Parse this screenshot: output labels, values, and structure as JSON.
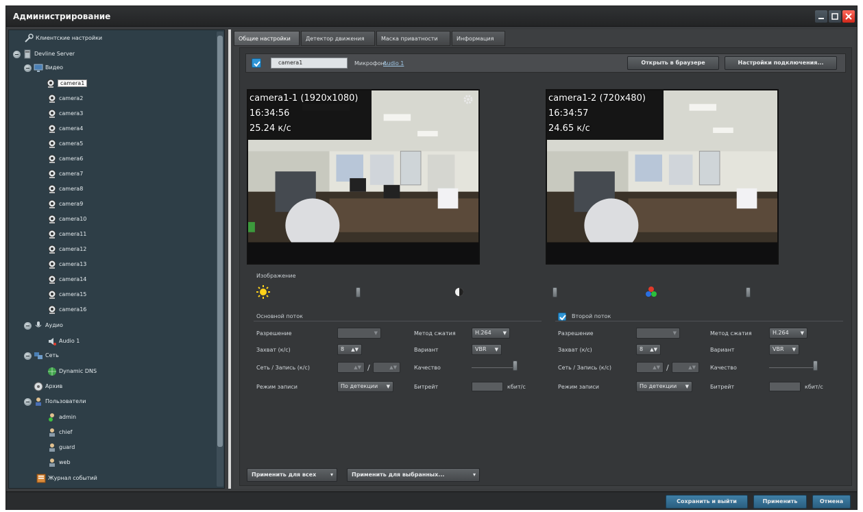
{
  "window": {
    "title": "Администрирование"
  },
  "sidebar": {
    "items": [
      {
        "label": "Клиентские настройки"
      },
      {
        "label": "Devline Server"
      },
      {
        "label": "Видео"
      },
      {
        "label": "camera1"
      },
      {
        "label": "camera2"
      },
      {
        "label": "camera3"
      },
      {
        "label": "camera4"
      },
      {
        "label": "camera5"
      },
      {
        "label": "camera6"
      },
      {
        "label": "camera7"
      },
      {
        "label": "camera8"
      },
      {
        "label": "camera9"
      },
      {
        "label": "camera10"
      },
      {
        "label": "camera11"
      },
      {
        "label": "camera12"
      },
      {
        "label": "camera13"
      },
      {
        "label": "camera14"
      },
      {
        "label": "camera15"
      },
      {
        "label": "camera16"
      },
      {
        "label": "Аудио"
      },
      {
        "label": "Audio 1"
      },
      {
        "label": "Сеть"
      },
      {
        "label": "Dynamic DNS"
      },
      {
        "label": "Архив"
      },
      {
        "label": "Пользователи"
      },
      {
        "label": "admin"
      },
      {
        "label": "chief"
      },
      {
        "label": "guard"
      },
      {
        "label": "web"
      },
      {
        "label": "Журнал событий"
      }
    ]
  },
  "tabs": [
    {
      "label": "Общие настройки"
    },
    {
      "label": "Детектор движения"
    },
    {
      "label": "Маска приватности"
    },
    {
      "label": "Информация"
    }
  ],
  "camera": {
    "name": "camera1",
    "mic_label": "Микрофон:",
    "mic_value": "Audio 1",
    "open_browser": "Открыть в браузере",
    "conn_settings": "Настройки подключения..."
  },
  "video1": {
    "title": "camera1-1 (1920x1080)",
    "time": "16:34:56",
    "fps": "25.24 к/с"
  },
  "video2": {
    "title": "camera1-2 (720x480)",
    "time": "16:34:57",
    "fps": "24.65 к/с"
  },
  "image_label": "Изображение",
  "main_stream": {
    "heading": "Основной поток",
    "resolution_label": "Разрешение",
    "fps_label": "Захват (к/с)",
    "fps_value": "8",
    "net_rec_label": "Сеть / Запись (к/с)",
    "rec_mode_label": "Режим записи",
    "rec_mode_value": "По детекции",
    "codec_label": "Метод сжатия",
    "codec_value": "H.264",
    "variant_label": "Вариант",
    "variant_value": "VBR",
    "quality_label": "Качество",
    "bitrate_label": "Битрейт",
    "bitrate_unit": "кбит/с"
  },
  "second_stream": {
    "heading": "Второй поток",
    "resolution_label": "Разрешение",
    "fps_label": "Захват (к/с)",
    "fps_value": "8",
    "net_rec_label": "Сеть / Запись (к/с)",
    "rec_mode_label": "Режим записи",
    "rec_mode_value": "По детекции",
    "codec_label": "Метод сжатия",
    "codec_value": "H.264",
    "variant_label": "Вариант",
    "variant_value": "VBR",
    "quality_label": "Качество",
    "bitrate_label": "Битрейт",
    "bitrate_unit": "кбит/с"
  },
  "apply_all": "Применить для всех",
  "apply_selected": "Применить для выбранных...",
  "footer": {
    "save_exit": "Сохранить и выйти",
    "apply": "Применить",
    "cancel": "Отмена"
  }
}
